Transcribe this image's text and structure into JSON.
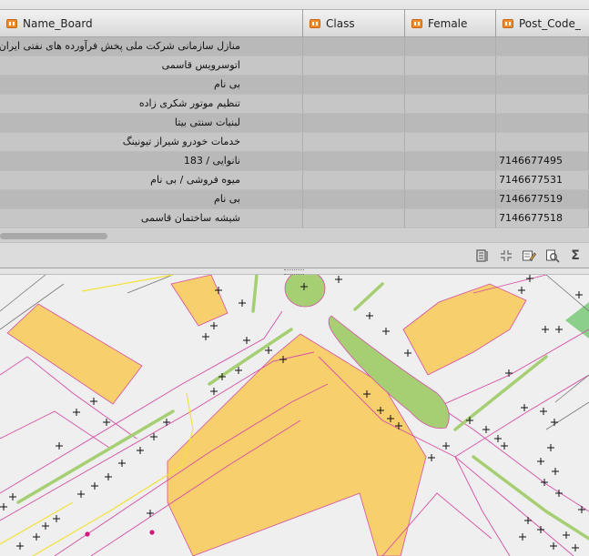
{
  "table": {
    "columns": [
      {
        "label": "Name_Board"
      },
      {
        "label": "Class"
      },
      {
        "label": "Female"
      },
      {
        "label": "Post_Code_"
      }
    ],
    "rows": [
      {
        "name": "منازل سازمانی شرکت ملی پخش فرآورده های نفتی ایران",
        "class": "",
        "female": "",
        "post": ""
      },
      {
        "name": "اتوسرویس قاسمی",
        "class": "",
        "female": "",
        "post": ""
      },
      {
        "name": "بی نام",
        "class": "",
        "female": "",
        "post": ""
      },
      {
        "name": "تنظیم موتور شکری زاده",
        "class": "",
        "female": "",
        "post": ""
      },
      {
        "name": "لبنیات سنتی بیتا",
        "class": "",
        "female": "",
        "post": ""
      },
      {
        "name": "خدمات خودرو شیراز تیونینگ",
        "class": "",
        "female": "",
        "post": ""
      },
      {
        "name": "نانوایی / 183",
        "class": "",
        "female": "",
        "post": "7146677495"
      },
      {
        "name": "میوه فروشی / بی نام",
        "class": "",
        "female": "",
        "post": "7146677531"
      },
      {
        "name": "بی نام",
        "class": "",
        "female": "",
        "post": "7146677519"
      },
      {
        "name": "شیشه ساختمان قاسمی",
        "class": "",
        "female": "",
        "post": "7146677518"
      }
    ]
  },
  "toolbar": {
    "icons": [
      "field-calculator-icon",
      "zoom-to-selection-icon",
      "edit-attributes-icon",
      "zoom-search-icon",
      "statistics-sigma-icon"
    ],
    "sigma_glyph": "Σ"
  },
  "map": {
    "colors": {
      "building": "#f7cf6c",
      "road_edge": "#d64fa6",
      "green": "#a6cf74",
      "park": "#8ccf8a",
      "yellow_line": "#f2e23a",
      "background": "#efefef",
      "point": "#d6157f"
    }
  }
}
